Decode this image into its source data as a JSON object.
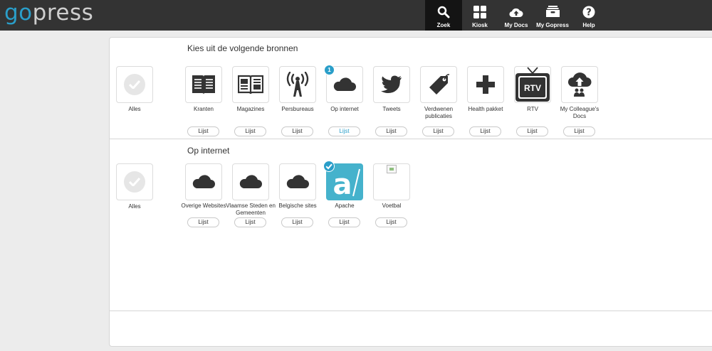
{
  "brand": {
    "part1": "go",
    "part2": "press"
  },
  "nav": [
    {
      "id": "zoek",
      "label": "Zoek",
      "icon": "search-icon",
      "active": true
    },
    {
      "id": "kiosk",
      "label": "Kiosk",
      "icon": "grid-icon",
      "active": false
    },
    {
      "id": "mydocs",
      "label": "My Docs",
      "icon": "cloud-upload-icon",
      "active": false
    },
    {
      "id": "mygopress",
      "label": "My Gopress",
      "icon": "archive-box-icon",
      "active": false
    },
    {
      "id": "help",
      "label": "Help",
      "icon": "help-icon",
      "active": false
    }
  ],
  "sections": {
    "sources": {
      "heading": "Kies uit de volgende bronnen",
      "all_label": "Alles",
      "items": [
        {
          "label": "Kranten",
          "icon": "newspaper-icon",
          "list_label": "Lijst"
        },
        {
          "label": "Magazines",
          "icon": "magazine-icon",
          "list_label": "Lijst"
        },
        {
          "label": "Persbureaus",
          "icon": "broadcast-tower-icon",
          "list_label": "Lijst"
        },
        {
          "label": "Op internet",
          "icon": "cloud-icon",
          "list_label": "Lijst",
          "badge": "1",
          "selected": true
        },
        {
          "label": "Tweets",
          "icon": "twitter-bird-icon",
          "list_label": "Lijst"
        },
        {
          "label": "Verdwenen publicaties",
          "icon": "tag-icon",
          "list_label": "Lijst"
        },
        {
          "label": "Health pakket",
          "icon": "plus-icon",
          "list_label": "Lijst"
        },
        {
          "label": "RTV",
          "icon": "tv-icon",
          "list_label": "Lijst",
          "icon_text": "RTV"
        },
        {
          "label": "My Colleague's Docs",
          "icon": "cloud-upload-people-icon",
          "list_label": "Lijst"
        }
      ]
    },
    "internet": {
      "heading": "Op internet",
      "all_label": "Alles",
      "items": [
        {
          "label": "Overige Websites",
          "icon": "cloud-icon",
          "list_label": "Lijst"
        },
        {
          "label": "Vlaamse Steden en Gemeenten",
          "icon": "cloud-icon",
          "list_label": "Lijst"
        },
        {
          "label": "Belgische sites",
          "icon": "cloud-icon",
          "list_label": "Lijst"
        },
        {
          "label": "Apache",
          "icon": "apache-logo-icon",
          "list_label": "Lijst",
          "checked": true
        },
        {
          "label": "Voetbal",
          "icon": "broken-image-icon",
          "list_label": "Lijst"
        }
      ]
    }
  },
  "colors": {
    "brand_blue": "#2a9ec9",
    "topbar": "#333333",
    "apache": "#45b2cc"
  }
}
